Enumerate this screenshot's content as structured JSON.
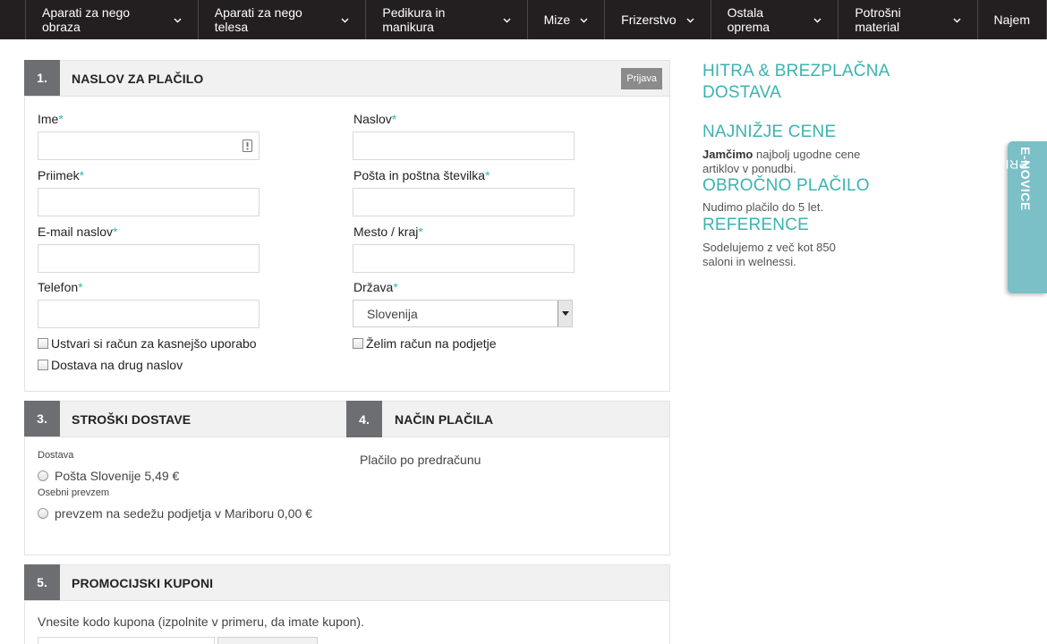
{
  "nav": {
    "items": [
      {
        "label": "Aparati za nego obraza",
        "has_dropdown": true
      },
      {
        "label": "Aparati za nego telesa",
        "has_dropdown": true
      },
      {
        "label": "Pedikura in manikura",
        "has_dropdown": true
      },
      {
        "label": "Mize",
        "has_dropdown": true
      },
      {
        "label": "Frizerstvo",
        "has_dropdown": true
      },
      {
        "label": "Ostala oprema",
        "has_dropdown": true
      },
      {
        "label": "Potrošni material",
        "has_dropdown": true
      },
      {
        "label": "Najem",
        "has_dropdown": false
      }
    ]
  },
  "billing": {
    "step": "1.",
    "title": "NASLOV ZA PLAČILO",
    "login_label": "Prijava",
    "required_mark": "*",
    "fields": {
      "first_name": {
        "label": "Ime",
        "value": ""
      },
      "last_name": {
        "label": "Priimek",
        "value": ""
      },
      "email": {
        "label": "E-mail naslov",
        "value": ""
      },
      "phone": {
        "label": "Telefon",
        "value": ""
      },
      "address": {
        "label": "Naslov",
        "value": ""
      },
      "postal": {
        "label": "Pošta in poštna številka",
        "value": ""
      },
      "city": {
        "label": "Mesto / kraj",
        "value": ""
      },
      "country": {
        "label": "Država",
        "value": "Slovenija"
      }
    },
    "checkboxes": {
      "create_account": {
        "label": "Ustvari si račun za kasnejšo uporabo",
        "checked": false
      },
      "company_invoice": {
        "label": "Želim račun na podjetje",
        "checked": false
      },
      "other_address": {
        "label": "Dostava na drug naslov",
        "checked": false
      }
    }
  },
  "shipping": {
    "step": "3.",
    "title": "STROŠKI DOSTAVE",
    "group1_label": "Dostava",
    "option1": "Pošta Slovenije 5,49 €",
    "group2_label": "Osebni prevzem",
    "option2": "prevzem na sedežu podjetja v Mariboru 0,00 €"
  },
  "payment": {
    "step": "4.",
    "title": "NAČIN PLAČILA",
    "method": "Plačilo po predračunu"
  },
  "coupons": {
    "step": "5.",
    "title": "PROMOCIJSKI KUPONI",
    "hint": "Vnesite kodo kupona (izpolnite v primeru, da imate kupon)."
  },
  "sidebar": {
    "h1": "HITRA & BREZPLAČNA DOSTAVA",
    "h2": "NAJNIŽJE CENE",
    "p2_bold": "Jamčimo",
    "p2_rest": " najbolj ugodne cene artiklov v ponudbi.",
    "h3": "OBROČNO PLAČILO",
    "p3": "Nudimo plačilo do 5 let.",
    "h4": "REFERENCE",
    "p4": "Sodelujemo z več kot 850 saloni in welnessi."
  },
  "newsletter": {
    "label_prefix": "PRIJAVA NA ",
    "label_bold": "E-NOVICE"
  },
  "colors": {
    "accent": "#3bb3b0",
    "nav_bg": "#231f20",
    "step_bg": "#6d6e71",
    "newsletter_bg": "#7bbfc7"
  }
}
